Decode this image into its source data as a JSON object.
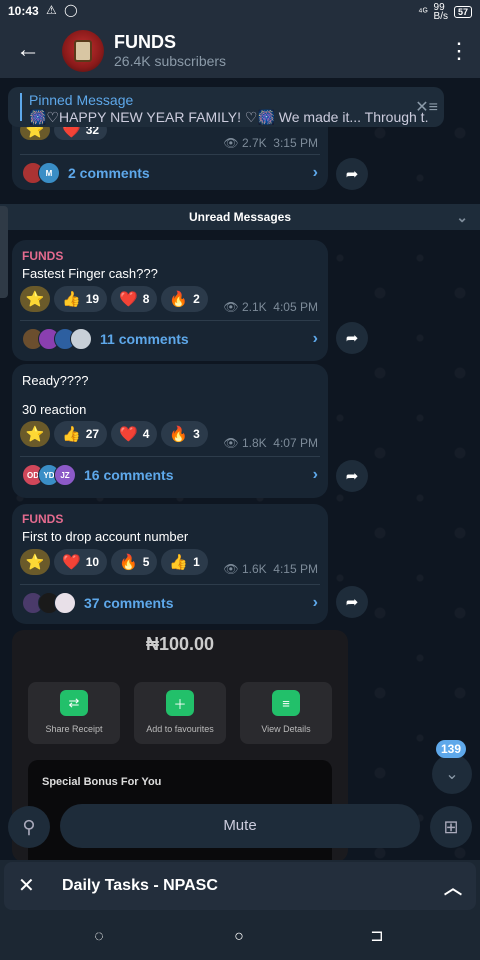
{
  "status": {
    "time": "10:43",
    "icons": "⚠ ◯",
    "network": "⁴ᴳ",
    "speed_top": "99",
    "speed_bottom": "B/s",
    "battery": "57"
  },
  "header": {
    "title": "FUNDS",
    "subtitle": "26.4K subscribers"
  },
  "pinned": {
    "title": "Pinned Message",
    "text": "🎆♡HAPPY NEW YEAR FAMILY! ♡🎆  We made it... Through t..."
  },
  "top_post": {
    "react_count": "32",
    "views": "2.7K",
    "time": "3:15 PM",
    "comments": "2 comments"
  },
  "unread_label": "Unread Messages",
  "messages": [
    {
      "sender": "FUNDS",
      "text": "Fastest Finger cash???",
      "thumbs": "19",
      "hearts": "8",
      "fire": "2",
      "views": "2.1K",
      "time": "4:05 PM",
      "comments": "11 comments"
    },
    {
      "text1": "Ready????",
      "text2": "30 reaction",
      "thumbs": "27",
      "hearts": "4",
      "fire": "3",
      "views": "1.8K",
      "time": "4:07 PM",
      "comments": "16 comments",
      "avatars": [
        "OD",
        "YD",
        "JZ"
      ]
    },
    {
      "sender": "FUNDS",
      "text": "First to drop account number",
      "hearts": "10",
      "fire": "5",
      "thumbs": "1",
      "views": "1.6K",
      "time": "4:15 PM",
      "comments": "37 comments"
    }
  ],
  "image": {
    "amount": "₦100.00",
    "actions": [
      "Share Receipt",
      "Add to favourites",
      "View Details"
    ],
    "bonus": "Special Bonus For You"
  },
  "scroll_badge": "139",
  "bottom": {
    "mute": "Mute"
  },
  "tasks": {
    "title": "Daily Tasks - NPASC"
  },
  "colors": {
    "accent": "#5ea8ea",
    "sender": "#e56b8f",
    "bubble": "#182533",
    "background": "#0e1621"
  }
}
